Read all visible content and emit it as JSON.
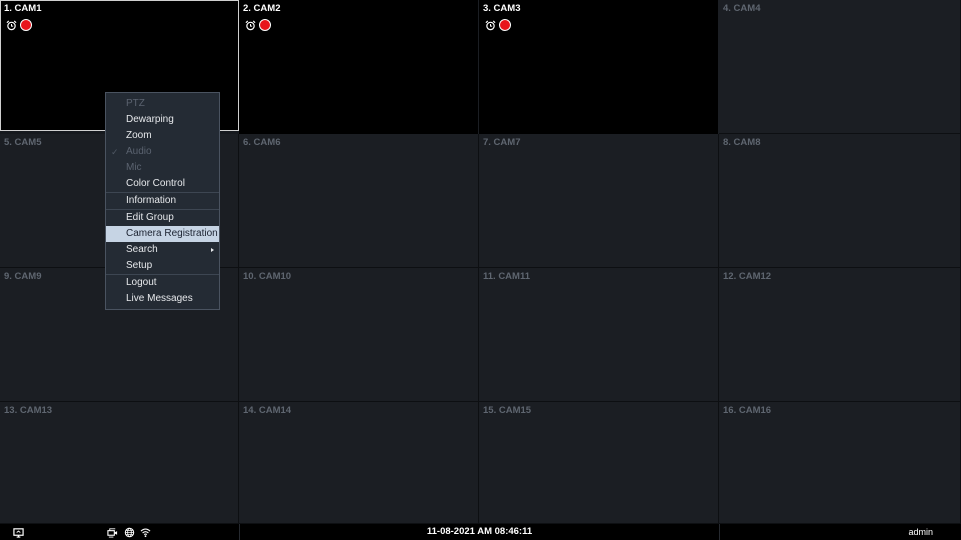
{
  "cameras": [
    {
      "title": "1. CAM1"
    },
    {
      "title": "2. CAM2"
    },
    {
      "title": "3. CAM3"
    },
    {
      "title": "4. CAM4"
    },
    {
      "title": "5. CAM5"
    },
    {
      "title": "6. CAM6"
    },
    {
      "title": "7. CAM7"
    },
    {
      "title": "8. CAM8"
    },
    {
      "title": "9. CAM9"
    },
    {
      "title": "10. CAM10"
    },
    {
      "title": "11. CAM11"
    },
    {
      "title": "12. CAM12"
    },
    {
      "title": "13. CAM13"
    },
    {
      "title": "14. CAM14"
    },
    {
      "title": "15. CAM15"
    },
    {
      "title": "16. CAM16"
    }
  ],
  "status_icons": [
    "alarm-clock-icon",
    "recording-dot-icon"
  ],
  "context_menu": {
    "items": [
      {
        "label": "PTZ",
        "disabled": true
      },
      {
        "label": "Dewarping"
      },
      {
        "label": "Zoom"
      },
      {
        "label": "Audio",
        "disabled": true,
        "checked": true
      },
      {
        "label": "Mic",
        "disabled": true
      },
      {
        "label": "Color Control"
      },
      {
        "label": "Information"
      },
      {
        "label": "Edit Group"
      },
      {
        "label": "Camera Registration",
        "highlighted": true
      },
      {
        "label": "Search",
        "submenu": true
      },
      {
        "label": "Setup"
      },
      {
        "label": "Logout"
      },
      {
        "label": "Live Messages"
      }
    ]
  },
  "statusbar": {
    "datetime": "11-08-2021  AM 08:46:11",
    "user": "admin",
    "icons": [
      "display-icon",
      "network-camera-icon",
      "globe-icon",
      "wifi-icon"
    ]
  },
  "colors": {
    "recording": "#e8141c",
    "menu_highlight": "#c6d4e4",
    "background": "#16191e"
  }
}
